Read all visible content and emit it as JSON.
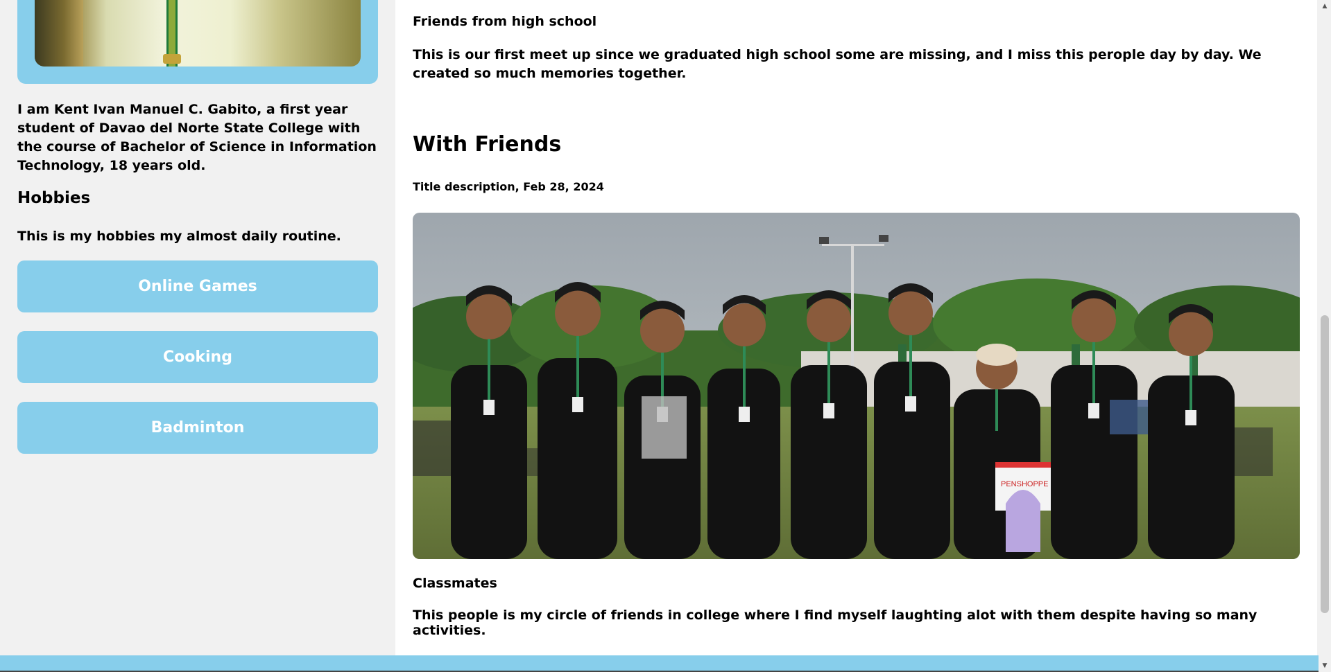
{
  "sidebar": {
    "bio": "I am Kent Ivan Manuel C. Gabito, a first year student of Davao del Norte State College with the course of Bachelor of Science in Information Technology, 18 years old.",
    "hobbies_heading": "Hobbies",
    "hobbies_desc": "This is my hobbies my almost daily routine.",
    "hobbies": [
      {
        "label": "Online Games"
      },
      {
        "label": "Cooking"
      },
      {
        "label": "Badminton"
      }
    ]
  },
  "main": {
    "previous_post": {
      "caption": "Friends from high school",
      "body": "This is our first meet up since we graduated high school some are missing, and I miss this perople day by day. We created so much memories together."
    },
    "section": {
      "heading": "With Friends",
      "subtitle": "Title description, Feb 28, 2024",
      "caption": "Classmates",
      "description": "This people is my circle of friends in college where I find myself laughting alot with them despite having so many activities.",
      "photo_bag_text": "PENSHOPPE"
    }
  },
  "colors": {
    "accent": "#87ceeb",
    "sidebar_bg": "#f1f1f1",
    "main_bg": "#ffffff"
  }
}
